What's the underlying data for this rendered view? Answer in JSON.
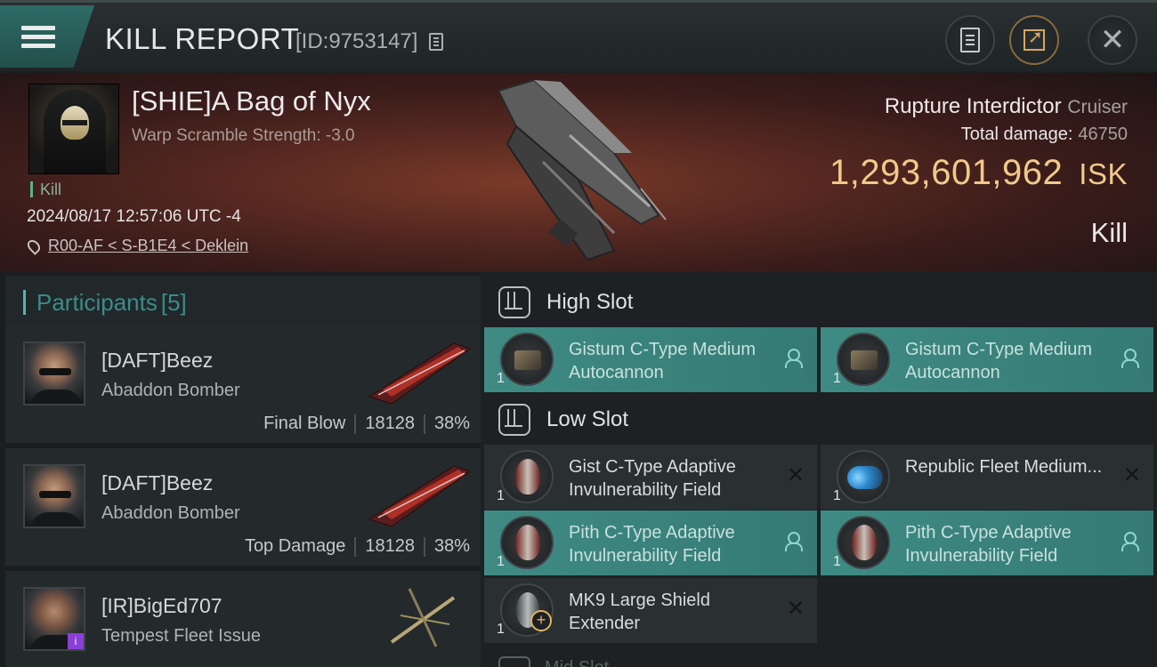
{
  "header": {
    "title": "KILL REPORT",
    "report_id": "[ID:9753147]"
  },
  "victim": {
    "name": "[SHIE]A Bag of Nyx",
    "warp_strength": "Warp Scramble Strength: -3.0",
    "tag": "Kill",
    "timestamp": "2024/08/17 12:57:06 UTC -4",
    "location": "R00-AF < S-B1E4 < Deklein",
    "ship": "Rupture Interdictor",
    "ship_class": "Cruiser",
    "total_damage_label": "Total damage:",
    "total_damage": "46750",
    "isk_value": "1,293,601,962",
    "isk_unit": "ISK",
    "result": "Kill"
  },
  "participants": {
    "label": "Participants",
    "count": "[5]",
    "items": [
      {
        "name": "[DAFT]Beez",
        "ship": "Abaddon Bomber",
        "role": "Final Blow",
        "damage": "18128",
        "percent": "38%"
      },
      {
        "name": "[DAFT]Beez",
        "ship": "Abaddon Bomber",
        "role": "Top Damage",
        "damage": "18128",
        "percent": "38%"
      },
      {
        "name": "[IR]BigEd707",
        "ship": "Tempest Fleet Issue"
      }
    ]
  },
  "fitting": {
    "high_slot_label": "High Slot",
    "low_slot_label": "Low Slot",
    "mid_slot_label": "Mid Slot",
    "high": [
      {
        "name": "Gistum C-Type Medium Autocannon",
        "qty": "1",
        "state": "fitted",
        "icon": "autocannon-icon"
      },
      {
        "name": "Gistum C-Type Medium Autocannon",
        "qty": "1",
        "state": "fitted",
        "icon": "autocannon-icon"
      }
    ],
    "low": [
      {
        "name": "Gist C-Type Adaptive Invulnerability Field",
        "qty": "1",
        "state": "destroyed",
        "icon": "shield-module-icon"
      },
      {
        "name": "Republic Fleet Medium...",
        "qty": "1",
        "state": "destroyed",
        "icon": "plasma-module-icon"
      },
      {
        "name": "Pith C-Type Adaptive Invulnerability Field",
        "qty": "1",
        "state": "fitted",
        "icon": "shield-module-icon"
      },
      {
        "name": "Pith C-Type Adaptive Invulnerability Field",
        "qty": "1",
        "state": "fitted",
        "icon": "shield-module-icon"
      },
      {
        "name": "MK9 Large Shield Extender",
        "qty": "1",
        "state": "destroyed",
        "icon": "shield-extender-icon"
      }
    ]
  },
  "colors": {
    "accent_teal": "#3f8b84",
    "isk_gold": "#f1c98a",
    "header_menu": "#2e6b66"
  }
}
